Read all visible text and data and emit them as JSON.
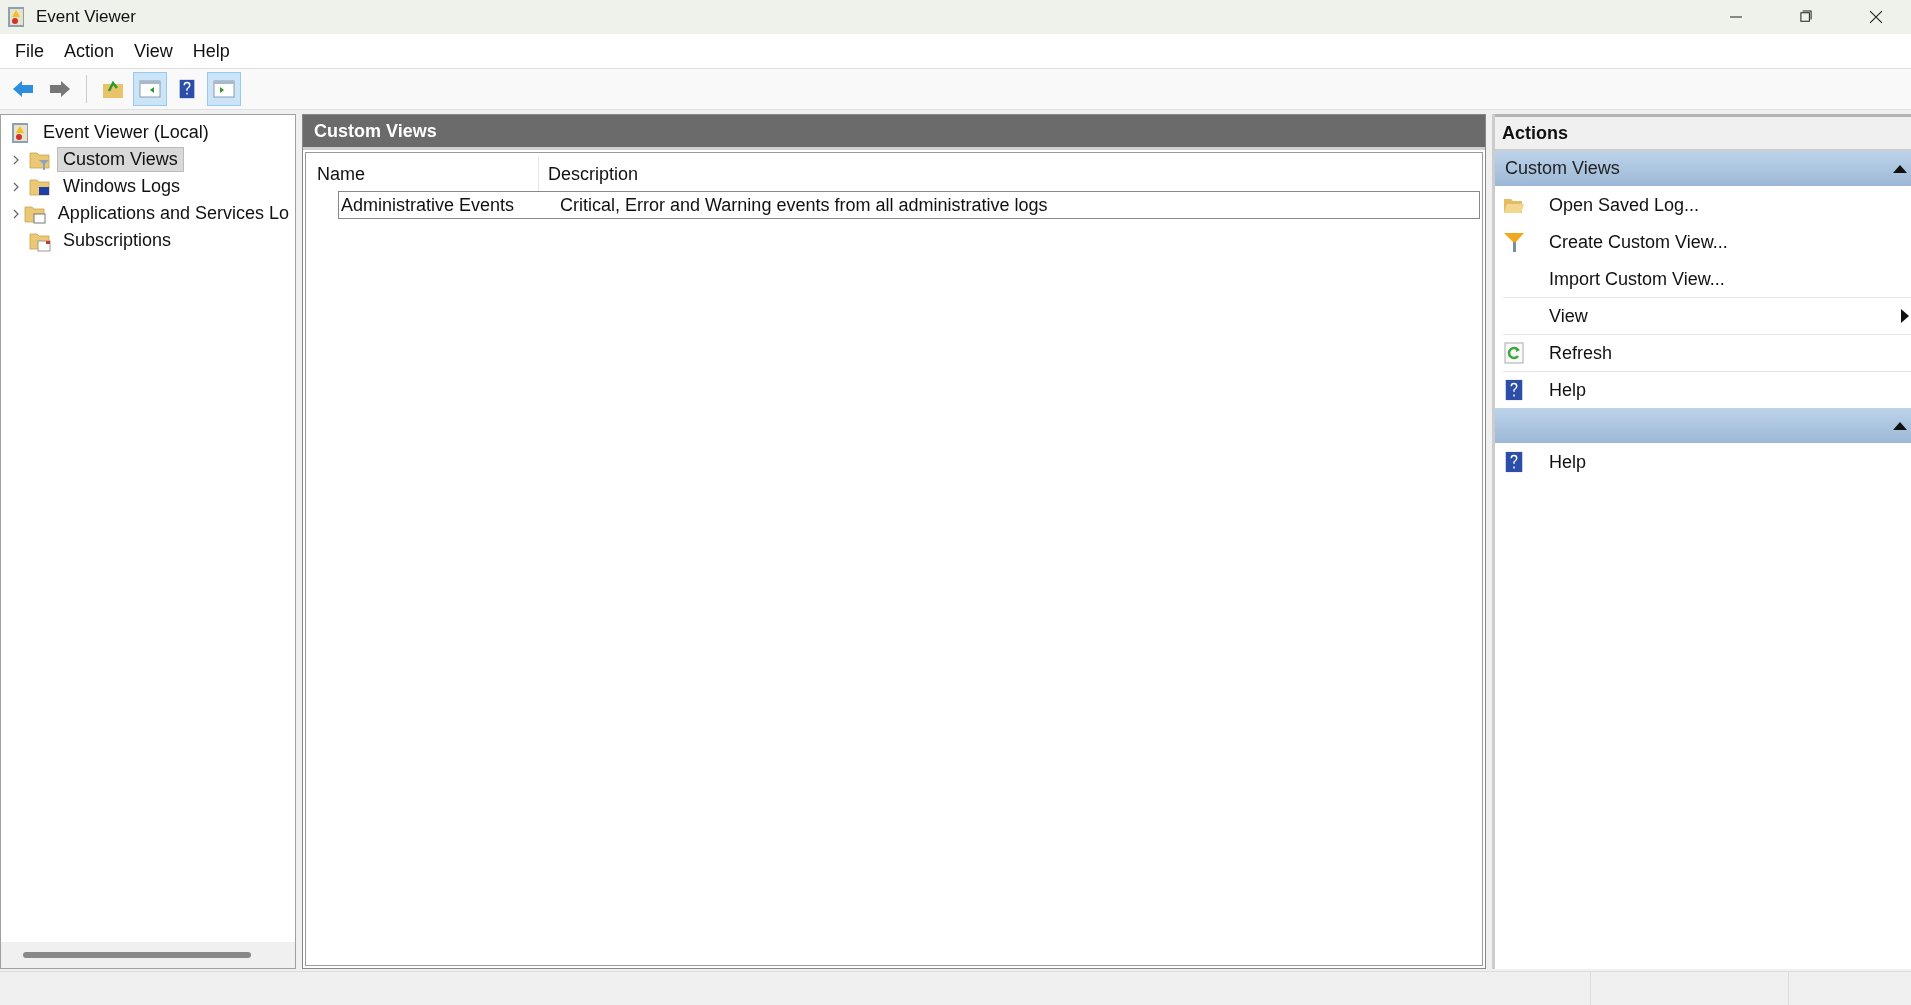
{
  "window": {
    "title": "Event Viewer"
  },
  "menu": [
    "File",
    "Action",
    "View",
    "Help"
  ],
  "toolbar": [
    {
      "kind": "back",
      "pressed": false
    },
    {
      "kind": "forward",
      "pressed": false
    },
    {
      "kind": "up",
      "pressed": false
    },
    {
      "kind": "tree-toggle",
      "pressed": true
    },
    {
      "kind": "help",
      "pressed": false
    },
    {
      "kind": "actions-toggle",
      "pressed": true
    }
  ],
  "tree": {
    "root": "Event Viewer (Local)",
    "children": [
      {
        "label": "Custom Views",
        "expanded": false,
        "selected": true
      },
      {
        "label": "Windows Logs",
        "expanded": false,
        "selected": false
      },
      {
        "label": "Applications and Services Lo",
        "expanded": false,
        "selected": false
      },
      {
        "label": "Subscriptions",
        "selected": false
      }
    ]
  },
  "center": {
    "title": "Custom Views",
    "table": {
      "columns": [
        "Name",
        "Description"
      ],
      "rows": [
        {
          "cells": [
            "Administrative Events",
            "Critical, Error and Warning events from all administrative logs"
          ],
          "selected": true
        }
      ]
    }
  },
  "actions": {
    "title": "Actions",
    "sections": [
      {
        "title": "Custom Views",
        "collapsed": false,
        "items": [
          {
            "label": "Open Saved Log...",
            "divider_above": false,
            "submenu": false
          },
          {
            "label": "Create Custom View...",
            "divider_above": false,
            "submenu": false
          },
          {
            "label": "Import Custom View...",
            "divider_above": false,
            "submenu": false
          },
          {
            "label": "View",
            "divider_above": true,
            "submenu": true
          },
          {
            "label": "Refresh",
            "divider_above": true,
            "submenu": false
          },
          {
            "label": "Help",
            "divider_above": true,
            "submenu": false
          }
        ]
      },
      {
        "collapsed": false,
        "items": [
          {
            "label": "Help",
            "divider_above": false,
            "submenu": false
          }
        ]
      }
    ]
  }
}
